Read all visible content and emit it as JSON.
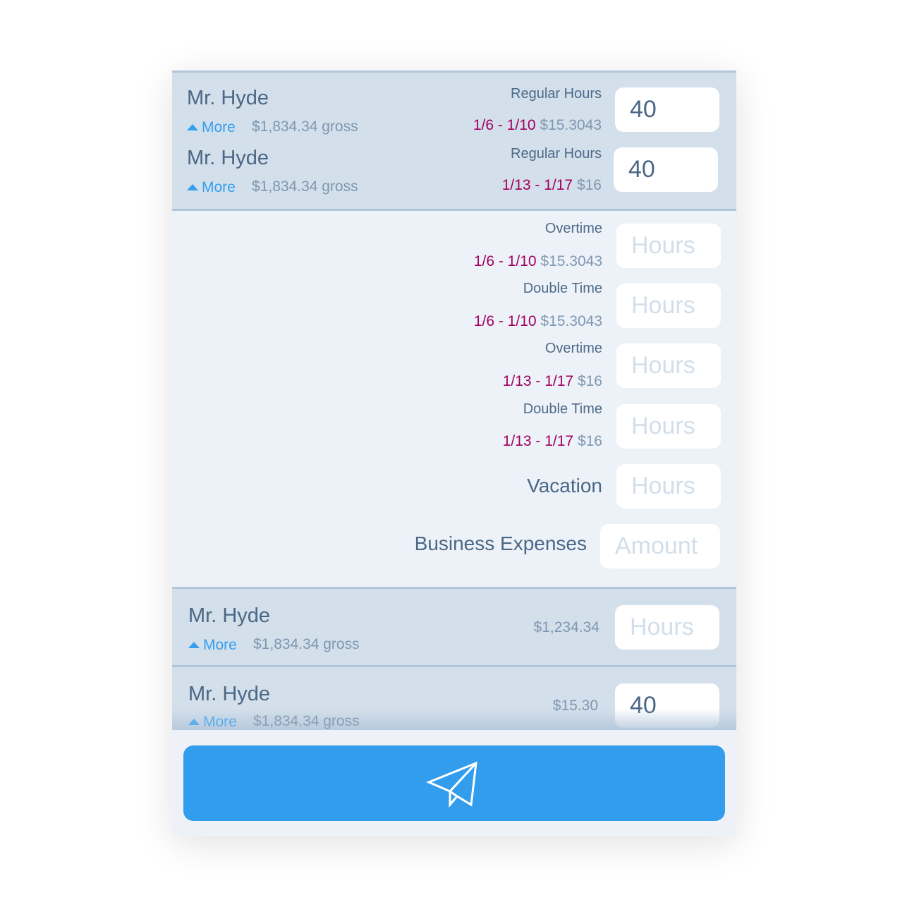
{
  "employees": [
    {
      "name": "Mr. Hyde",
      "more": "More",
      "gross": "$1,834.34 gross",
      "label": "Regular Hours",
      "period": "1/6 - 1/10",
      "rate": "$15.3043",
      "value": "40"
    },
    {
      "name": "Mr. Hyde",
      "more": "More",
      "gross": "$1,834.34 gross",
      "label": "Regular Hours",
      "period": "1/13 - 1/17",
      "rate": "$16",
      "value": "40"
    }
  ],
  "details": [
    {
      "label": "Overtime",
      "period": "1/6 - 1/10",
      "rate": "$15.3043",
      "placeholder": "Hours"
    },
    {
      "label": "Double Time",
      "period": "1/6 - 1/10",
      "rate": "$15.3043",
      "placeholder": "Hours"
    },
    {
      "label": "Overtime",
      "period": "1/13 - 1/17",
      "rate": "$16",
      "placeholder": "Hours"
    },
    {
      "label": "Double Time",
      "period": "1/13 - 1/17",
      "rate": "$16",
      "placeholder": "Hours"
    }
  ],
  "vacation": {
    "label": "Vacation",
    "placeholder": "Hours"
  },
  "expenses": {
    "label": "Business Expenses",
    "placeholder": "Amount"
  },
  "rows": [
    {
      "name": "Mr. Hyde",
      "more": "More",
      "gross": "$1,834.34 gross",
      "amount": "$1,234.34",
      "placeholder": "Hours"
    },
    {
      "name": "Mr. Hyde",
      "more": "More",
      "gross": "$1,834.34 gross",
      "amount": "$15.30",
      "value": "40"
    }
  ],
  "send_icon": "paper-plane-icon",
  "colors": {
    "accent": "#339ded",
    "period": "#a1005f"
  }
}
